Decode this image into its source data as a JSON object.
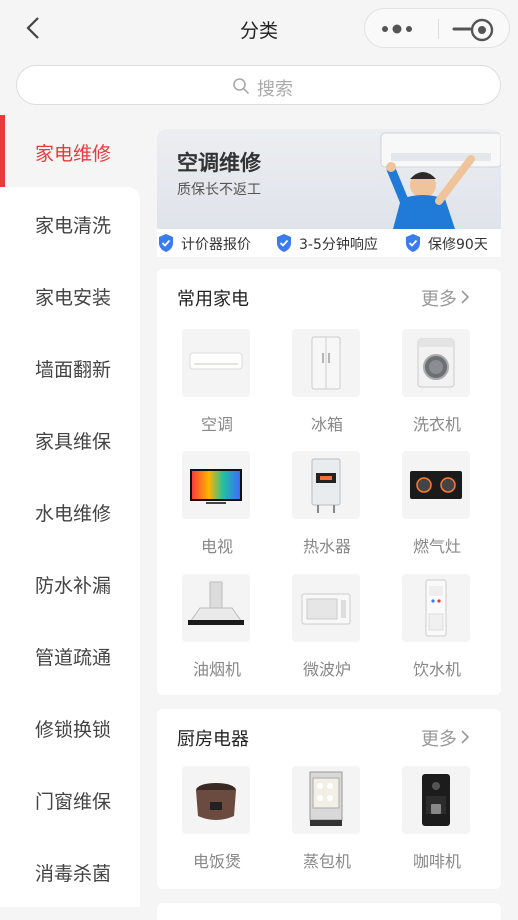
{
  "navbar": {
    "title": "分类"
  },
  "search": {
    "placeholder": "搜索"
  },
  "sidebar": {
    "items": [
      {
        "label": "家电维修",
        "active": true
      },
      {
        "label": "家电清洗"
      },
      {
        "label": "家电安装"
      },
      {
        "label": "墙面翻新"
      },
      {
        "label": "家具维保"
      },
      {
        "label": "水电维修"
      },
      {
        "label": "防水补漏"
      },
      {
        "label": "管道疏通"
      },
      {
        "label": "修锁换锁"
      },
      {
        "label": "门窗维保"
      },
      {
        "label": "消毒杀菌"
      }
    ]
  },
  "banner": {
    "title": "空调维修",
    "subtitle": "质保长不返工",
    "guarantees": [
      "计价器报价",
      "3-5分钟响应",
      "保修90天"
    ]
  },
  "sections": [
    {
      "title": "常用家电",
      "more": "更多",
      "items": [
        {
          "name": "空调",
          "icon": "air-conditioner-icon"
        },
        {
          "name": "冰箱",
          "icon": "refrigerator-icon"
        },
        {
          "name": "洗衣机",
          "icon": "washing-machine-icon"
        },
        {
          "name": "电视",
          "icon": "tv-icon"
        },
        {
          "name": "热水器",
          "icon": "water-heater-icon"
        },
        {
          "name": "燃气灶",
          "icon": "gas-stove-icon"
        },
        {
          "name": "油烟机",
          "icon": "range-hood-icon"
        },
        {
          "name": "微波炉",
          "icon": "microwave-icon"
        },
        {
          "name": "饮水机",
          "icon": "water-dispenser-icon"
        }
      ]
    },
    {
      "title": "厨房电器",
      "more": "更多",
      "items": [
        {
          "name": "电饭煲",
          "icon": "rice-cooker-icon"
        },
        {
          "name": "蒸包机",
          "icon": "bun-steamer-icon"
        },
        {
          "name": "咖啡机",
          "icon": "coffee-machine-icon"
        }
      ]
    }
  ],
  "colors": {
    "accent": "#e63b3b",
    "shield": "#3a7bef"
  }
}
